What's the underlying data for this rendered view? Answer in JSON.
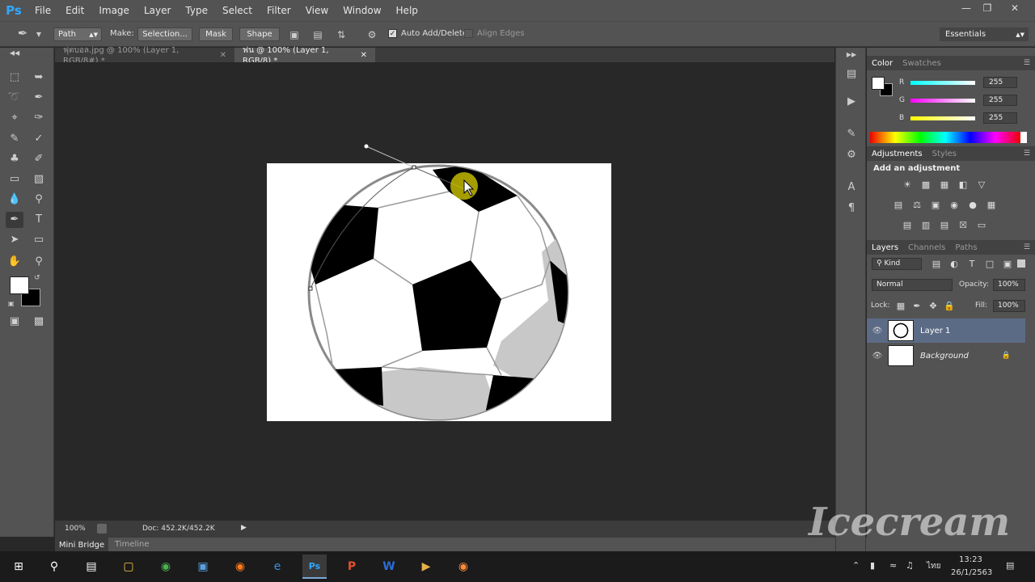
{
  "app": {
    "logo": "Ps"
  },
  "menu": [
    "File",
    "Edit",
    "Image",
    "Layer",
    "Type",
    "Select",
    "Filter",
    "View",
    "Window",
    "Help"
  ],
  "window_controls": [
    "minimize-icon",
    "restore-icon",
    "close-icon"
  ],
  "options_bar": {
    "tool_mode": "Path",
    "make_label": "Make:",
    "selection_btn": "Selection...",
    "mask_btn": "Mask",
    "shape_btn": "Shape",
    "auto_add_delete": "Auto Add/Delete",
    "auto_add_delete_checked": true,
    "align_edges": "Align Edges",
    "align_edges_checked": false,
    "workspace": "Essentials"
  },
  "tabs": [
    {
      "label": "ฟุตบอล.jpg @ 100% (Layer 1, RGB/8#) *",
      "active": false
    },
    {
      "label": "ฟน @ 100% (Layer 1, RGB/8) *",
      "active": true
    }
  ],
  "status": {
    "zoom": "100%",
    "doc": "Doc: 452.2K/452.2K"
  },
  "bottom_tabs": {
    "mini_bridge": "Mini Bridge",
    "timeline": "Timeline"
  },
  "color_panel": {
    "tabs": [
      "Color",
      "Swatches"
    ],
    "r_label": "R",
    "r_value": "255",
    "g_label": "G",
    "g_value": "255",
    "b_label": "B",
    "b_value": "255"
  },
  "adjustments_panel": {
    "tabs": [
      "Adjustments",
      "Styles"
    ],
    "heading": "Add an adjustment"
  },
  "layers_panel": {
    "tabs": [
      "Layers",
      "Channels",
      "Paths"
    ],
    "filter": "Kind",
    "blend_mode": "Normal",
    "opacity_label": "Opacity:",
    "opacity": "100%",
    "lock_label": "Lock:",
    "fill_label": "Fill:",
    "fill": "100%",
    "layers": [
      {
        "name": "Layer 1",
        "selected": true
      },
      {
        "name": "Background",
        "selected": false,
        "locked": true
      }
    ]
  },
  "taskbar": {
    "time": "13:23",
    "date": "26/1/2563",
    "lang": "ไทย"
  },
  "watermark": "Icecream"
}
